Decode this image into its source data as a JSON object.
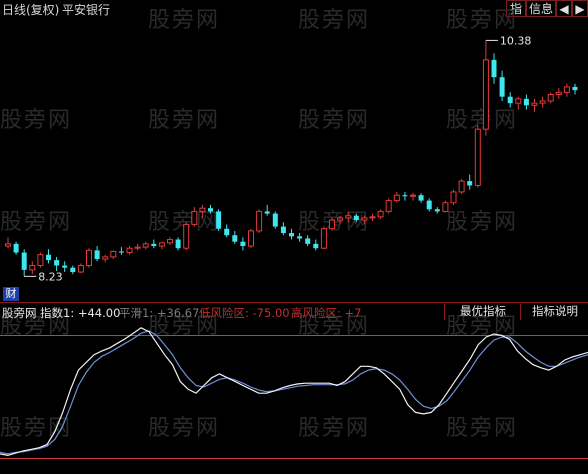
{
  "window": {
    "period_label": "日线(复权)",
    "stock_name": "平安银行",
    "buttons": {
      "indicator": "指",
      "info": "信息",
      "prev": "◀",
      "next": "▶"
    }
  },
  "watermark": "股旁网",
  "price_panel": {
    "high_marker": "10.38",
    "low_marker": "8.23",
    "cai_icon": "财",
    "colors": {
      "up": "#e23a3a",
      "down": "#3ee6ee",
      "marker": "#e6e6e6"
    },
    "candles": [
      [
        8.48,
        8.56,
        8.46,
        8.5
      ],
      [
        8.5,
        8.52,
        8.4,
        8.42
      ],
      [
        8.42,
        8.45,
        8.2,
        8.26
      ],
      [
        8.26,
        8.34,
        8.22,
        8.3
      ],
      [
        8.3,
        8.42,
        8.28,
        8.4
      ],
      [
        8.4,
        8.45,
        8.32,
        8.35
      ],
      [
        8.35,
        8.38,
        8.25,
        8.3
      ],
      [
        8.3,
        8.34,
        8.24,
        8.28
      ],
      [
        8.28,
        8.3,
        8.22,
        8.24
      ],
      [
        8.24,
        8.32,
        8.23,
        8.3
      ],
      [
        8.3,
        8.46,
        8.28,
        8.44
      ],
      [
        8.44,
        8.48,
        8.34,
        8.36
      ],
      [
        8.36,
        8.4,
        8.33,
        8.38
      ],
      [
        8.38,
        8.44,
        8.36,
        8.43
      ],
      [
        8.43,
        8.47,
        8.4,
        8.42
      ],
      [
        8.42,
        8.48,
        8.4,
        8.46
      ],
      [
        8.46,
        8.5,
        8.44,
        8.47
      ],
      [
        8.47,
        8.52,
        8.45,
        8.5
      ],
      [
        8.5,
        8.54,
        8.46,
        8.48
      ],
      [
        8.48,
        8.52,
        8.45,
        8.51
      ],
      [
        8.51,
        8.56,
        8.49,
        8.54
      ],
      [
        8.54,
        8.56,
        8.44,
        8.46
      ],
      [
        8.46,
        8.7,
        8.44,
        8.68
      ],
      [
        8.68,
        8.84,
        8.66,
        8.8
      ],
      [
        8.8,
        8.86,
        8.74,
        8.83
      ],
      [
        8.83,
        8.86,
        8.78,
        8.8
      ],
      [
        8.8,
        8.82,
        8.62,
        8.64
      ],
      [
        8.64,
        8.68,
        8.56,
        8.58
      ],
      [
        8.58,
        8.62,
        8.5,
        8.52
      ],
      [
        8.52,
        8.56,
        8.44,
        8.48
      ],
      [
        8.48,
        8.64,
        8.46,
        8.62
      ],
      [
        8.62,
        8.82,
        8.6,
        8.8
      ],
      [
        8.8,
        8.86,
        8.76,
        8.78
      ],
      [
        8.78,
        8.8,
        8.64,
        8.66
      ],
      [
        8.66,
        8.7,
        8.58,
        8.6
      ],
      [
        8.6,
        8.64,
        8.54,
        8.57
      ],
      [
        8.57,
        8.6,
        8.52,
        8.55
      ],
      [
        8.55,
        8.58,
        8.48,
        8.5
      ],
      [
        8.5,
        8.54,
        8.44,
        8.46
      ],
      [
        8.46,
        8.66,
        8.45,
        8.64
      ],
      [
        8.64,
        8.74,
        8.62,
        8.72
      ],
      [
        8.72,
        8.76,
        8.68,
        8.74
      ],
      [
        8.74,
        8.8,
        8.7,
        8.76
      ],
      [
        8.76,
        8.78,
        8.7,
        8.72
      ],
      [
        8.72,
        8.76,
        8.68,
        8.74
      ],
      [
        8.74,
        8.78,
        8.71,
        8.75
      ],
      [
        8.75,
        8.82,
        8.73,
        8.8
      ],
      [
        8.8,
        8.92,
        8.78,
        8.9
      ],
      [
        8.9,
        8.98,
        8.88,
        8.95
      ],
      [
        8.95,
        8.98,
        8.9,
        8.94
      ],
      [
        8.94,
        8.97,
        8.9,
        8.95
      ],
      [
        8.95,
        8.97,
        8.88,
        8.9
      ],
      [
        8.9,
        8.92,
        8.8,
        8.82
      ],
      [
        8.82,
        8.84,
        8.78,
        8.8
      ],
      [
        8.8,
        8.9,
        8.79,
        8.88
      ],
      [
        8.88,
        9.0,
        8.86,
        8.98
      ],
      [
        8.98,
        9.1,
        8.96,
        9.08
      ],
      [
        9.08,
        9.14,
        9.0,
        9.04
      ],
      [
        9.04,
        9.6,
        9.02,
        9.56
      ],
      [
        9.56,
        10.38,
        9.5,
        10.2
      ],
      [
        10.2,
        10.26,
        9.98,
        10.04
      ],
      [
        10.04,
        10.1,
        9.82,
        9.86
      ],
      [
        9.86,
        9.9,
        9.76,
        9.8
      ],
      [
        9.8,
        9.86,
        9.74,
        9.84
      ],
      [
        9.84,
        9.88,
        9.74,
        9.78
      ],
      [
        9.78,
        9.84,
        9.72,
        9.8
      ],
      [
        9.8,
        9.86,
        9.76,
        9.82
      ],
      [
        9.82,
        9.9,
        9.8,
        9.88
      ],
      [
        9.88,
        9.94,
        9.84,
        9.9
      ],
      [
        9.9,
        9.98,
        9.86,
        9.95
      ],
      [
        9.95,
        9.98,
        9.88,
        9.92
      ]
    ]
  },
  "indicator": {
    "name": "股旁网",
    "index_label": "指数1: +44.00",
    "ping_label": "平滑1: +36.67",
    "low_risk_label": "低风险区: -75.00",
    "high_risk_label": "高风险区: +7",
    "best_button": "最优指标",
    "help_button": "指标说明",
    "colors": {
      "fast": "#f2f2f2",
      "slow": "#6f8fd6",
      "level": "#d23a3a"
    },
    "levels": [
      80,
      -80
    ],
    "fast": [
      -74,
      -76,
      -73,
      -70,
      -68,
      -66,
      -62,
      -45,
      -20,
      10,
      35,
      45,
      55,
      60,
      64,
      70,
      76,
      83,
      90,
      85,
      70,
      55,
      42,
      20,
      10,
      5,
      15,
      25,
      30,
      25,
      20,
      15,
      10,
      5,
      5,
      8,
      12,
      15,
      17,
      18,
      18,
      18,
      18,
      15,
      20,
      30,
      40,
      40,
      38,
      30,
      20,
      10,
      -10,
      -20,
      -22,
      -20,
      -10,
      5,
      20,
      35,
      50,
      68,
      78,
      82,
      80,
      75,
      60,
      50,
      42,
      38,
      35,
      40,
      48,
      52,
      55,
      58
    ],
    "slow": [
      -72,
      -74,
      -72,
      -71,
      -69,
      -67,
      -64,
      -55,
      -38,
      -12,
      15,
      32,
      45,
      53,
      58,
      64,
      70,
      76,
      83,
      86,
      80,
      68,
      55,
      38,
      25,
      15,
      13,
      18,
      23,
      25,
      22,
      18,
      13,
      9,
      7,
      8,
      10,
      12,
      14,
      15,
      16,
      16,
      16,
      16,
      17,
      22,
      30,
      35,
      37,
      35,
      30,
      22,
      10,
      -3,
      -12,
      -15,
      -12,
      -5,
      8,
      22,
      36,
      52,
      64,
      74,
      78,
      78,
      70,
      60,
      52,
      45,
      40,
      40,
      44,
      48,
      52,
      55
    ]
  }
}
